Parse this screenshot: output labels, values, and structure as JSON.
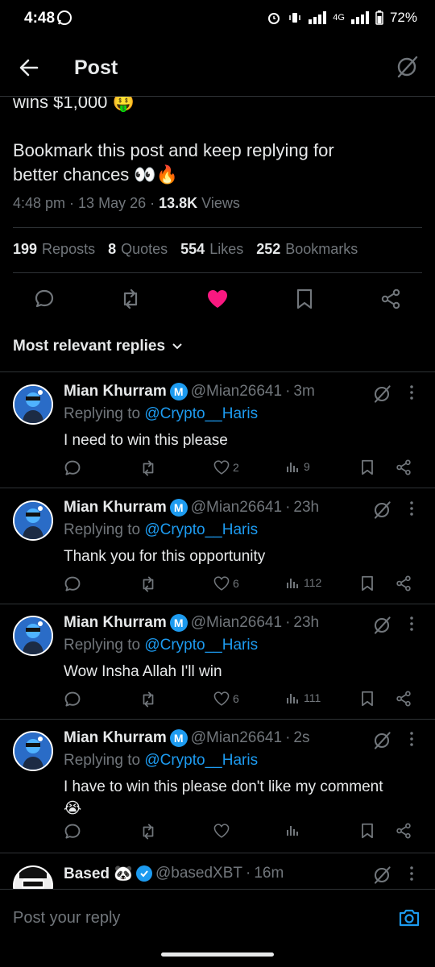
{
  "status_bar": {
    "time": "4:48",
    "network": "4G",
    "battery": "72%"
  },
  "header": {
    "title": "Post"
  },
  "post": {
    "line_partial": "wins $1,000 🤑",
    "line1": "Bookmark this post and keep replying for",
    "line2": "better chances 👀🔥",
    "time": "4:48 pm",
    "date": "13 May 26",
    "views_count": "13.8K",
    "views_label": "Views"
  },
  "stats": {
    "reposts_count": "199",
    "reposts_label": "Reposts",
    "quotes_count": "8",
    "quotes_label": "Quotes",
    "likes_count": "554",
    "likes_label": "Likes",
    "bookmarks_count": "252",
    "bookmarks_label": "Bookmarks"
  },
  "sort": {
    "label": "Most relevant replies"
  },
  "replies": [
    {
      "name": "Mian Khurram",
      "badge": "M",
      "handle": "@Mian26641",
      "age": "3m",
      "replying_prefix": "Replying to",
      "replying_to": "@Crypto__Haris",
      "text": "I need to win this please",
      "likes": "2",
      "views": "9"
    },
    {
      "name": "Mian Khurram",
      "badge": "M",
      "handle": "@Mian26641",
      "age": "23h",
      "replying_prefix": "Replying to",
      "replying_to": "@Crypto__Haris",
      "text": "Thank you for this opportunity",
      "likes": "6",
      "views": "112"
    },
    {
      "name": "Mian Khurram",
      "badge": "M",
      "handle": "@Mian26641",
      "age": "23h",
      "replying_prefix": "Replying to",
      "replying_to": "@Crypto__Haris",
      "text": "Wow Insha Allah I'll win",
      "likes": "6",
      "views": "111"
    },
    {
      "name": "Mian Khurram",
      "badge": "M",
      "handle": "@Mian26641",
      "age": "2s",
      "replying_prefix": "Replying to",
      "replying_to": "@Crypto__Haris",
      "text": "I have to win this please don't like my comment",
      "text2": "😭",
      "likes": "",
      "views": ""
    },
    {
      "name": "Based 🐼",
      "handle": "@basedXBT",
      "age": "16m"
    }
  ],
  "compose": {
    "placeholder": "Post your reply"
  },
  "colors": {
    "accent": "#1d9bf0",
    "like": "#f91880",
    "muted": "#71767b",
    "text": "#e7e9ea",
    "border": "#2f3336"
  }
}
